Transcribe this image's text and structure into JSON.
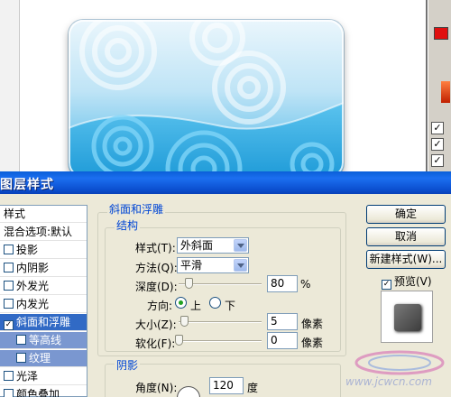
{
  "dialog": {
    "title": "图层样式",
    "styles_header": "样式",
    "style_items": [
      {
        "label": "混合选项:默认",
        "checkbox": false,
        "checked": false,
        "state": "normal"
      },
      {
        "label": "投影",
        "checkbox": true,
        "checked": false,
        "state": "normal"
      },
      {
        "label": "内阴影",
        "checkbox": true,
        "checked": false,
        "state": "normal"
      },
      {
        "label": "外发光",
        "checkbox": true,
        "checked": false,
        "state": "normal"
      },
      {
        "label": "内发光",
        "checkbox": true,
        "checked": false,
        "state": "normal"
      },
      {
        "label": "斜面和浮雕",
        "checkbox": true,
        "checked": true,
        "state": "selected"
      },
      {
        "label": "等高线",
        "checkbox": true,
        "checked": false,
        "state": "sub"
      },
      {
        "label": "纹理",
        "checkbox": true,
        "checked": false,
        "state": "sub"
      },
      {
        "label": "光泽",
        "checkbox": true,
        "checked": false,
        "state": "normal"
      },
      {
        "label": "颜色叠加",
        "checkbox": true,
        "checked": false,
        "state": "normal"
      }
    ],
    "bevel": {
      "group_title": "斜面和浮雕",
      "structure_title": "结构",
      "style_label": "样式(T):",
      "style_value": "外斜面",
      "technique_label": "方法(Q):",
      "technique_value": "平滑",
      "depth_label": "深度(D):",
      "depth_value": "80",
      "depth_unit": "%",
      "depth_level": 0.08,
      "direction_label": "方向:",
      "direction_up": "上",
      "direction_down": "下",
      "direction_selected": "上",
      "size_label": "大小(Z):",
      "size_value": "5",
      "size_unit": "像素",
      "size_level": 0.03,
      "soften_label": "软化(F):",
      "soften_value": "0",
      "soften_unit": "像素",
      "soften_level": 0.0
    },
    "shading": {
      "title": "阴影",
      "angle_label": "角度(N):",
      "angle_value": "120",
      "angle_unit": "度"
    },
    "buttons": {
      "ok": "确定",
      "cancel": "取消",
      "new_style": "新建样式(W)...",
      "preview_label": "预览(V)",
      "preview_checked": true
    }
  },
  "watermark": {
    "text": "www.jcwcn.com"
  },
  "colors": {
    "title_bar": "#0b4fd0",
    "selection": "#316ac5",
    "dialog_bg": "#ece9d8",
    "swatch_red": "#e01010"
  }
}
